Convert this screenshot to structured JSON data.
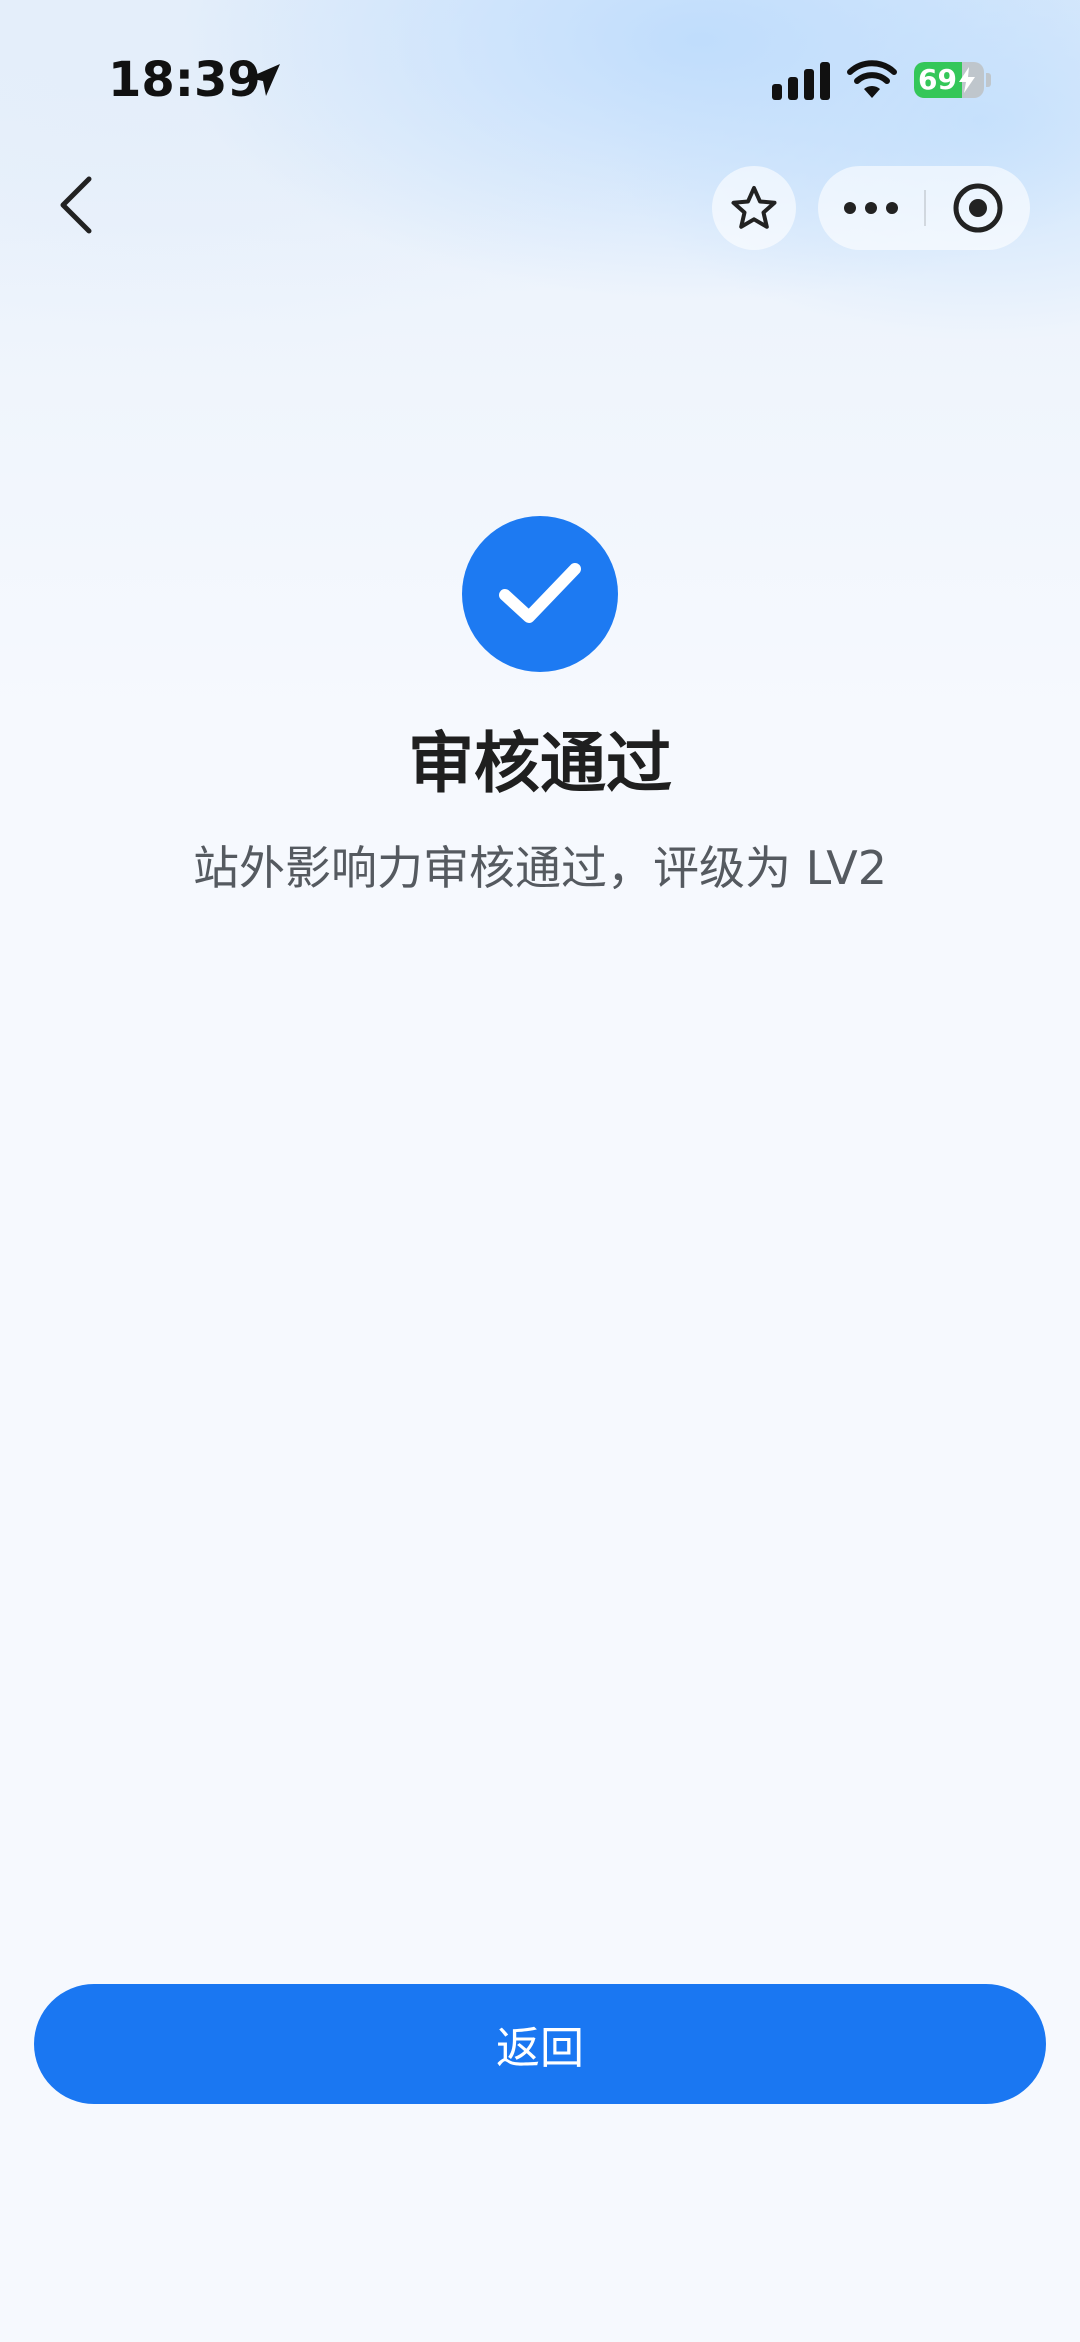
{
  "status_bar": {
    "time": "18:39",
    "battery_level": "69",
    "battery_fraction": 0.69,
    "icons": [
      "location-arrow-icon",
      "cellular-signal-icon",
      "wifi-icon",
      "battery-charging-icon"
    ]
  },
  "nav": {
    "icons": [
      "chevron-left-icon",
      "star-icon",
      "more-dots-icon",
      "target-close-icon"
    ]
  },
  "result": {
    "title": "审核通过",
    "description": "站外影响力审核通过，评级为 LV2",
    "icon": "check-circle-icon"
  },
  "actions": {
    "return_label": "返回"
  },
  "colors": {
    "primary": "#1a77f2",
    "battery": "#34c759"
  }
}
